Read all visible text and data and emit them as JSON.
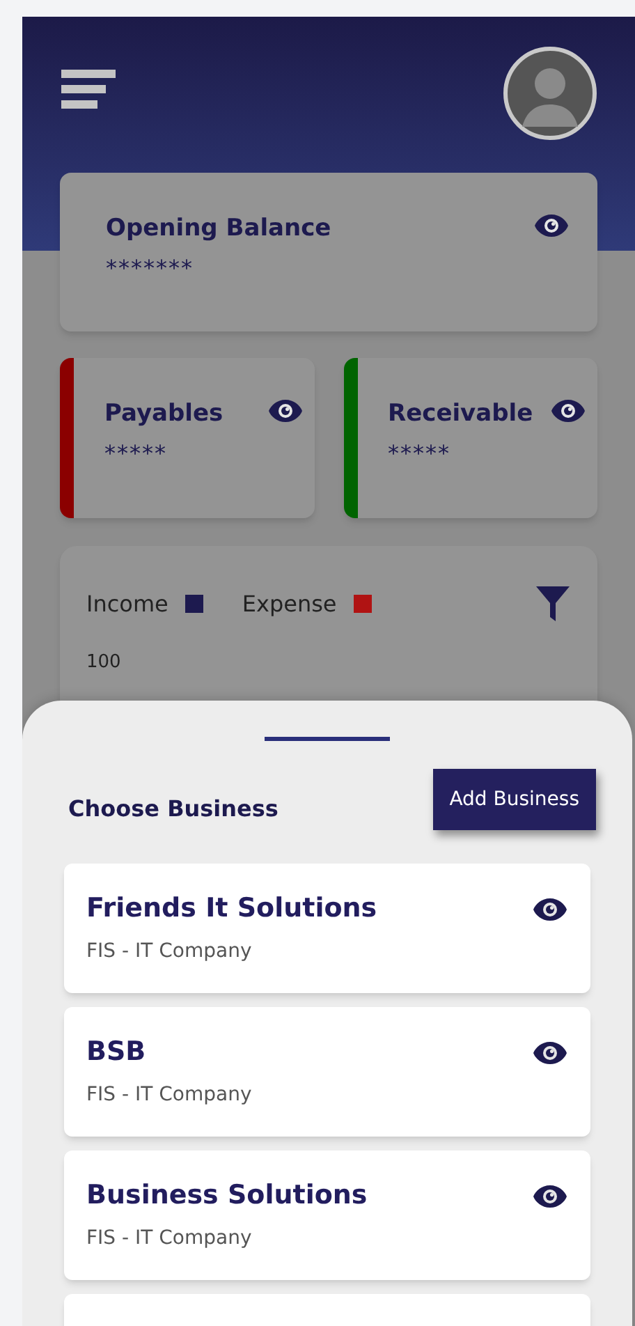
{
  "opening_balance": {
    "title": "Opening Balance",
    "value": "*******"
  },
  "summary_cards": [
    {
      "title": "Payables",
      "value": "*****",
      "color": "#8b0000"
    },
    {
      "title": "Receivable",
      "value": "*****",
      "color": "#006400"
    }
  ],
  "chart_card": {
    "legend": [
      {
        "label": "Income",
        "color": "#1d1a4f"
      },
      {
        "label": "Expense",
        "color": "#b01313"
      }
    ],
    "axis_label": "100"
  },
  "sheet": {
    "title": "Choose Business",
    "button": "Add Business",
    "businesses": [
      {
        "name": "Friends It Solutions",
        "subtitle": "FIS - IT Company"
      },
      {
        "name": "BSB",
        "subtitle": "FIS - IT Company"
      },
      {
        "name": "Business Solutions",
        "subtitle": "FIS - IT Company"
      }
    ]
  }
}
